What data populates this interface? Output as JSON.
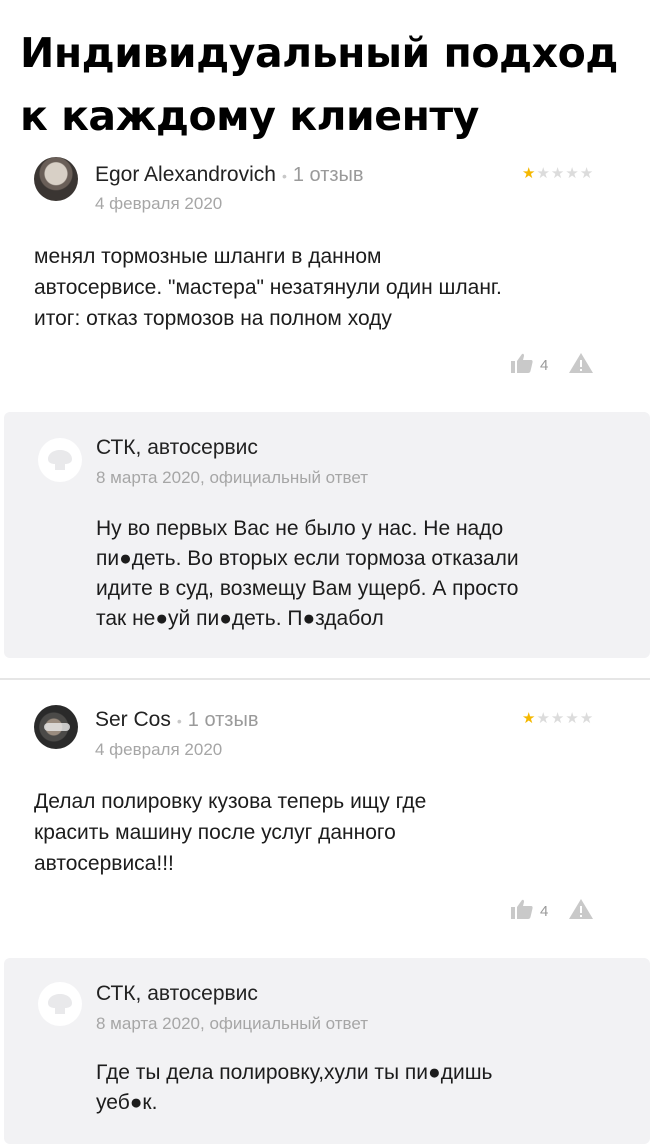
{
  "headline": {
    "line1": "Индивидуальный подход",
    "line2": "к каждому клиенту"
  },
  "reviews": [
    {
      "author": "Egor Alexandrovich",
      "review_count": "1 отзыв",
      "date": "4 февраля 2020",
      "rating": 1,
      "rating_max": 5,
      "text_lines": [
        "менял тормозные шланги в данном",
        "автосервисе. \"мастера\" незатянули один шланг.",
        "итог: отказ тормозов на полном ходу"
      ],
      "likes": "4",
      "reply": {
        "author": "СТК, автосервис",
        "date": "8 марта 2020, официальный ответ",
        "text_lines": [
          "Ну во первых Вас не было у нас. Не надо",
          "пи●деть. Во вторых если тормоза отказали",
          "идите в суд, возмещу Вам ущерб. А просто",
          "так не●уй пи●деть. П●здабол"
        ]
      }
    },
    {
      "author": "Ser Cos",
      "review_count": "1 отзыв",
      "date": "4 февраля 2020",
      "rating": 1,
      "rating_max": 5,
      "text_lines": [
        "Делал полировку кузова теперь ищу где",
        "красить машину после услуг данного",
        "автосервиса!!!"
      ],
      "likes": "4",
      "reply": {
        "author": "СТК, автосервис",
        "date": "8 марта 2020, официальный ответ",
        "text_lines": [
          "Где ты дела полировку,хули ты пи●дишь",
          "уеб●к."
        ]
      }
    }
  ],
  "colors": {
    "star_on": "#f5b800",
    "star_off": "#dcdcdc",
    "reply_bg": "#f2f2f4",
    "meta_gray": "#a6a6a6"
  },
  "icons": [
    "like-icon",
    "report-icon",
    "stct-logo-icon"
  ]
}
